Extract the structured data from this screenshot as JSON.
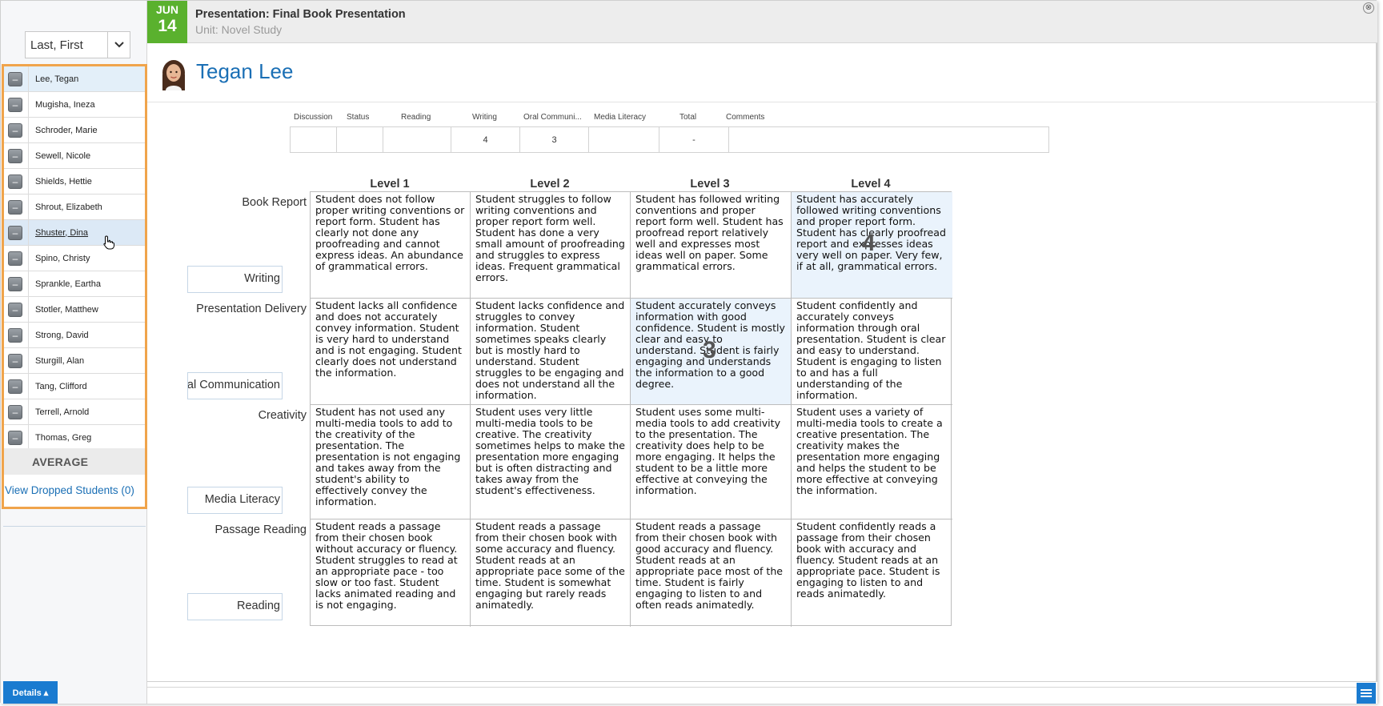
{
  "header": {
    "date_month": "JUN",
    "date_day": "14",
    "title": "Presentation: Final Book Presentation",
    "unit": "Unit: Novel Study",
    "close_glyph": "⊗"
  },
  "sidebar": {
    "sort_label": "Last, First",
    "students": [
      "Lee, Tegan",
      "Mugisha, Ineza",
      "Schroder, Marie",
      "Sewell, Nicole",
      "Shields, Hettie",
      "Shrout, Elizabeth",
      "Shuster, Dina",
      "Spino, Christy",
      "Sprankle, Eartha",
      "Stotler, Matthew",
      "Strong, David",
      "Sturgill, Alan",
      "Tang, Clifford",
      "Terrell, Arnold",
      "Thomas, Greg"
    ],
    "drop_glyph": "–",
    "average_label": "AVERAGE",
    "dropped_link": "View Dropped Students (0)"
  },
  "student": {
    "name": "Tegan Lee"
  },
  "scores": {
    "headers": [
      "Discussion",
      "Status",
      "Reading",
      "Writing",
      "Oral Communi...",
      "Media Literacy",
      "Total",
      "Comments"
    ],
    "values": [
      "",
      "",
      "",
      "4",
      "3",
      "",
      "-",
      ""
    ]
  },
  "rubric": {
    "levels": [
      "Level 1",
      "Level 2",
      "Level 3",
      "Level 4"
    ],
    "criteria": [
      {
        "label": "Book Report",
        "sub": "Writing",
        "score": "4",
        "cells": [
          "Student does not follow proper writing conventions or report form. Student has clearly not done any proofreading and cannot express ideas. An abundance of grammatical errors.",
          "Student struggles to follow writing conventions and proper report form well. Student has done a very small amount of proofreading and struggles to express ideas. Frequent grammatical errors.",
          "Student has followed writing conventions and proper report form well. Student has proofread report relatively well and expresses most ideas well on paper. Some grammatical errors.",
          "Student has accurately followed writing conventions and proper report form. Student has clearly proofread report and expresses ideas very well on paper. Very few, if at all, grammatical errors."
        ]
      },
      {
        "label": "Presentation Delivery",
        "sub": "Oral Communication",
        "score": "3",
        "cells": [
          "Student lacks all confidence and does not accurately convey information. Student is very hard to understand and is not engaging. Student clearly does not understand the information.",
          "Student lacks confidence and struggles to convey information. Student sometimes speaks clearly but is mostly hard to understand. Student struggles to be engaging and does not understand all the information.",
          "Student accurately conveys information with good confidence. Student is mostly clear and easy to understand. Student is fairly engaging and understands the information to a good degree.",
          "Student confidently and accurately conveys information through oral presentation. Student is clear and easy to understand. Student is engaging to listen to and has a full understanding of the information."
        ]
      },
      {
        "label": "Creativity",
        "sub": "Media Literacy",
        "score": "",
        "cells": [
          "Student has not used any multi-media tools to add to the creativity of the presentation. The presentation is not engaging and takes away from the student's ability to effectively convey the information.",
          "Student uses very little multi-media tools to be creative. The creativity sometimes helps to make the presentation more engaging but is often distracting and takes away from the student's effectiveness.",
          "Student uses some multi-media tools to add creativity to the presentation. The creativity does help to be more engaging. It helps the student to be a little more effective at conveying the information.",
          "Student uses a variety of multi-media tools to create a creative presentation. The creativity makes the presentation more engaging and helps the student to be more effective at conveying the information."
        ]
      },
      {
        "label": "Passage Reading",
        "sub": "Reading",
        "score": "",
        "cells": [
          "Student reads a passage from their chosen book without accuracy or fluency. Student struggles to read at an appropriate pace - too slow or too fast. Student lacks animated reading and is not engaging.",
          "Student reads a passage from their chosen book with some accuracy and fluency. Student reads at an appropriate pace some of the time. Student is somewhat engaging but rarely reads animatedly.",
          "Student reads a passage from their chosen book with good accuracy and fluency. Student reads at an appropriate pace most of the time. Student is fairly engaging to listen to and often reads animatedly.",
          "Student confidently reads a passage from their chosen book with accuracy and fluency. Student reads at an appropriate pace. Student is engaging to listen to and reads animatedly."
        ]
      }
    ]
  },
  "footer": {
    "details_label": "Details ▴"
  },
  "colors": {
    "accent_blue": "#1a6fb5",
    "date_green": "#5ab12e",
    "highlight_orange": "#f0a44b",
    "selected_cell": "#eaf3fc"
  }
}
